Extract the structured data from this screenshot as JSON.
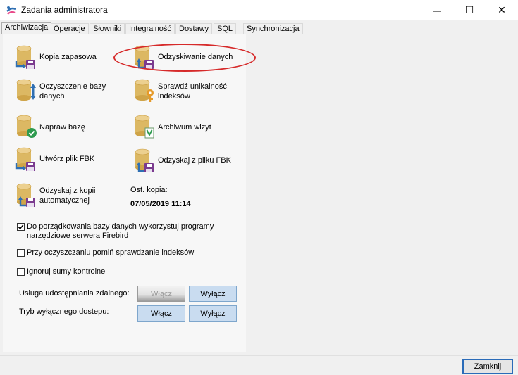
{
  "window": {
    "title": "Zadania administratora",
    "minimize_label": "—",
    "maximize_label": "☐",
    "close_label": "✕"
  },
  "tabs": [
    {
      "label": "Archiwizacja",
      "active": true
    },
    {
      "label": "Operacje"
    },
    {
      "label": "Słowniki"
    },
    {
      "label": "Integralność"
    },
    {
      "label": "Dostawy"
    },
    {
      "label": "SQL"
    },
    {
      "label": "Synchronizacja"
    }
  ],
  "actions": {
    "backup": "Kopia zapasowa",
    "restore": "Odzyskiwanie danych",
    "cleanup_line1": "Oczyszczenie bazy",
    "cleanup_line2": "danych",
    "check_unique_line1": "Sprawdź unikalność",
    "check_unique_line2": "indeksów",
    "repair": "Napraw bazę",
    "archive_visits": "Archiwum wizyt",
    "create_fbk": "Utwórz plik FBK",
    "restore_fbk": "Odzyskaj z pliku FBK",
    "restore_auto_line1": "Odzyskaj z kopii",
    "restore_auto_line2": "automatycznej"
  },
  "last_backup": {
    "label": "Ost. kopia:",
    "value": "07/05/2019 11:14"
  },
  "options": {
    "use_firebird_line1": "Do porządkowania bazy danych wykorzystuj programy",
    "use_firebird_line2": "narzędziowe serwera Firebird",
    "use_firebird_checked": true,
    "skip_index_check": "Przy oczyszczaniu pomiń sprawdzanie indeksów",
    "skip_index_check_checked": false,
    "ignore_checksums": "Ignoruj sumy kontrolne",
    "ignore_checksums_checked": false
  },
  "remote_share": {
    "label": "Usługa udostępniania zdalnego:",
    "enable": "Włącz",
    "disable": "Wyłącz",
    "enable_disabled": true
  },
  "exclusive_mode": {
    "label": "Tryb wyłącznego dostepu:",
    "enable": "Włącz",
    "disable": "Wyłącz"
  },
  "footer": {
    "close_button": "Zamknij"
  },
  "colors": {
    "db_gold": "#d8b25a",
    "arrow_blue": "#2f6fb3",
    "floppy_purple": "#7b3b8f",
    "check_green": "#2e9b4f",
    "highlight_red": "#d62a2a"
  }
}
